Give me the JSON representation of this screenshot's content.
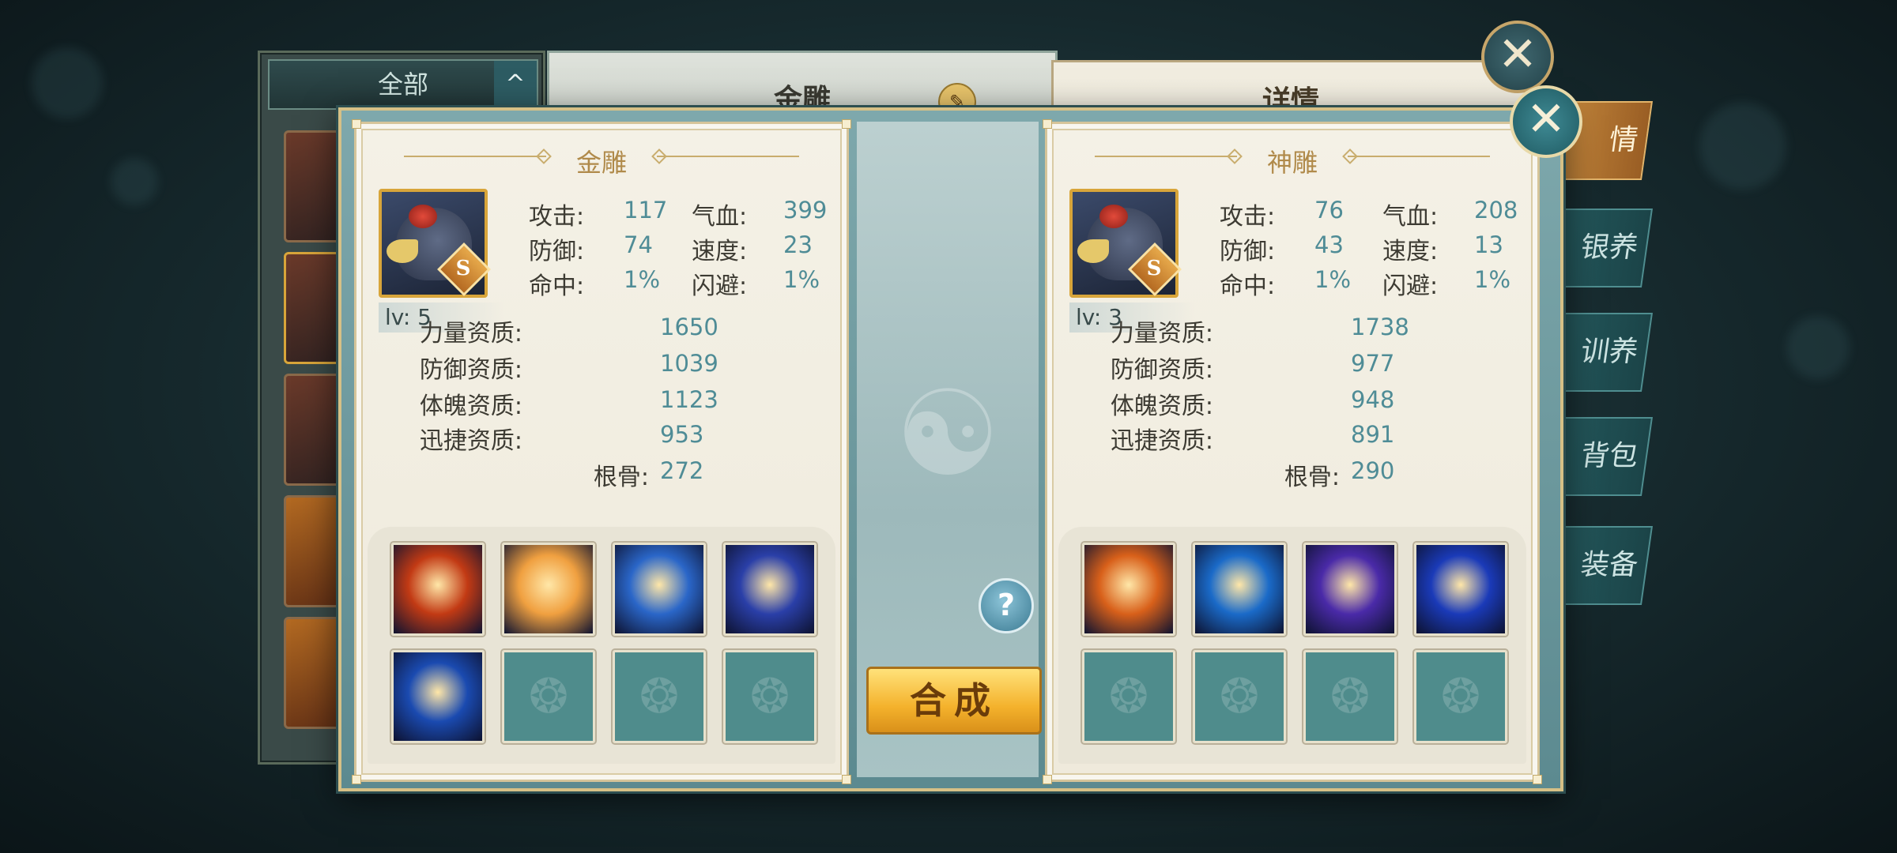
{
  "background": {
    "filter": {
      "label": "全部",
      "arrow": "^"
    },
    "middle_title": "金雕",
    "detail_title": "详情",
    "side_tabs": [
      {
        "label": "情",
        "active": true
      },
      {
        "label": "银养",
        "active": false
      },
      {
        "label": "训养",
        "active": false
      },
      {
        "label": "背包",
        "active": false
      },
      {
        "label": "装备",
        "active": false
      }
    ],
    "close_glyph": "✕"
  },
  "dialog": {
    "close_glyph": "✕",
    "help_glyph": "?",
    "compose_label": "合成",
    "left": {
      "title": "金雕",
      "grade": "S",
      "level": "lv: 5",
      "stats": [
        {
          "label": "攻击:",
          "value": "117"
        },
        {
          "label": "气血:",
          "value": "399"
        },
        {
          "label": "防御:",
          "value": "74"
        },
        {
          "label": "速度:",
          "value": "23"
        },
        {
          "label": "命中:",
          "value": "1%"
        },
        {
          "label": "闪避:",
          "value": "1%"
        }
      ],
      "aptitudes": [
        {
          "label": "力量资质:",
          "value": "1650"
        },
        {
          "label": "防御资质:",
          "value": "1039"
        },
        {
          "label": "体魄资质:",
          "value": "1123"
        },
        {
          "label": "迅捷资质:",
          "value": "953"
        },
        {
          "label": "根骨:",
          "value": "272"
        }
      ],
      "skills": [
        {
          "icon": "fire-orb-skill-icon",
          "color": "#c23a14"
        },
        {
          "icon": "flame-lion-skill-icon",
          "color": "#f0a040"
        },
        {
          "icon": "lightning-shield-skill-icon",
          "color": "#2a66c8"
        },
        {
          "icon": "claw-slash-skill-icon",
          "color": "#2a3fa8"
        },
        {
          "icon": "ice-shatter-skill-icon",
          "color": "#1a4ab0"
        },
        {
          "icon": "empty-slot-icon",
          "color": ""
        },
        {
          "icon": "empty-slot-icon",
          "color": ""
        },
        {
          "icon": "empty-slot-icon",
          "color": ""
        }
      ]
    },
    "right": {
      "title": "神雕",
      "grade": "S",
      "level": "lv: 3",
      "stats": [
        {
          "label": "攻击:",
          "value": "76"
        },
        {
          "label": "气血:",
          "value": "208"
        },
        {
          "label": "防御:",
          "value": "43"
        },
        {
          "label": "速度:",
          "value": "13"
        },
        {
          "label": "命中:",
          "value": "1%"
        },
        {
          "label": "闪避:",
          "value": "1%"
        }
      ],
      "aptitudes": [
        {
          "label": "力量资质:",
          "value": "1738"
        },
        {
          "label": "防御资质:",
          "value": "977"
        },
        {
          "label": "体魄资质:",
          "value": "948"
        },
        {
          "label": "迅捷资质:",
          "value": "891"
        },
        {
          "label": "根骨:",
          "value": "290"
        }
      ],
      "skills": [
        {
          "icon": "phoenix-skill-icon",
          "color": "#d8601a"
        },
        {
          "icon": "wind-blade-skill-icon",
          "color": "#1a6ac8"
        },
        {
          "icon": "void-orb-skill-icon",
          "color": "#4a2aa8"
        },
        {
          "icon": "vortex-skill-icon",
          "color": "#1a3ab8"
        },
        {
          "icon": "empty-slot-icon",
          "color": ""
        },
        {
          "icon": "empty-slot-icon",
          "color": ""
        },
        {
          "icon": "empty-slot-icon",
          "color": ""
        },
        {
          "icon": "empty-slot-icon",
          "color": ""
        }
      ]
    }
  }
}
